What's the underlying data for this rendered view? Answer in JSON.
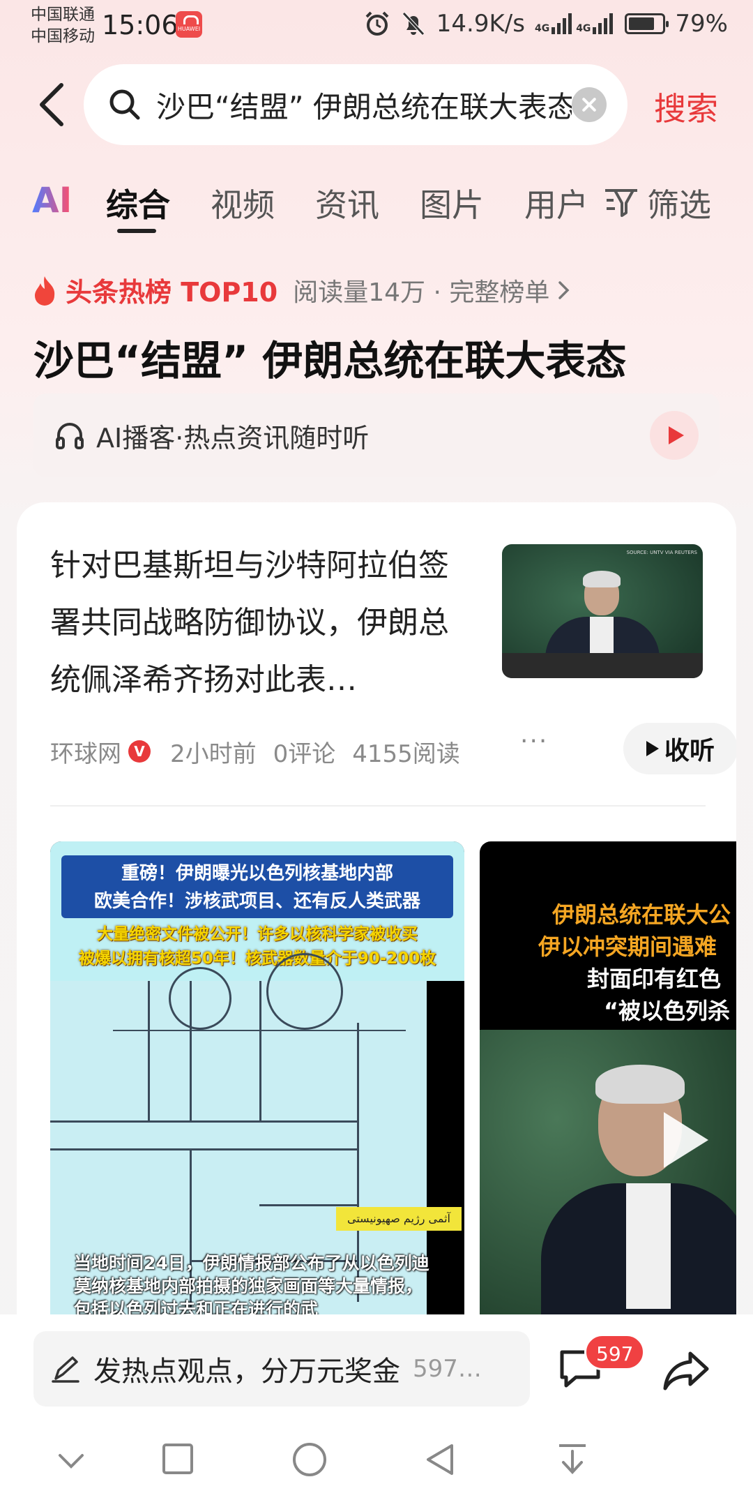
{
  "status_bar": {
    "carrier_1": "中国联通",
    "carrier_2": "中国移动",
    "time": "15:06",
    "app_badge": "HUAWEI",
    "net_speed": "14.9K/s",
    "net_tag_1": "4G",
    "net_tag_2": "4G",
    "battery_pct": "79%",
    "battery_level": 0.79,
    "icons": [
      "alarm-icon",
      "mute-icon",
      "signal-icon",
      "battery-icon"
    ]
  },
  "search": {
    "query": "沙巴“结盟” 伊朗总统在联大表态",
    "submit_label": "搜索"
  },
  "tabs": {
    "ai": "AI",
    "items": [
      "综合",
      "视频",
      "资讯",
      "图片",
      "用户"
    ],
    "active_index": 0,
    "filter_label": "筛选"
  },
  "hot": {
    "label": "头条热榜 TOP10",
    "meta": "阅读量14万 · 完整榜单",
    "title": "沙巴“结盟” 伊朗总统在联大表态",
    "podcast": "AI播客·热点资讯随时听"
  },
  "article": {
    "title": "针对巴基斯坦与沙特阿拉伯签署共同战略防御协议，伊朗总统佩泽希齐扬对此表…",
    "source": "环球网",
    "verified_mark": "V",
    "time": "2小时前",
    "comments": "0评论",
    "reads": "4155阅读",
    "more": "···",
    "listen": "收听",
    "thumb_credit": "SOURCE: UNTV VIA REUTERS"
  },
  "media_left": {
    "banner_line1": "重磅！伊朗曝光以色列核基地内部",
    "banner_line2": "欧美合作！涉核武项目、还有反人类武器",
    "yellow_line1": "大量绝密文件被公开！许多以核科学家被收买",
    "yellow_line2": "被爆以拥有核超50年！核武器数量介于90-200枚",
    "sticker": "آثمی رژیم صهیونیستی",
    "caption": "当地时间24日，伊朗情报部公布了从以色列迪莫纳核基地内部拍摄的独家画面等大量情报，包括以色列过去和正在进行的武"
  },
  "media_right": {
    "line1": "伊朗总统在联大公",
    "line2": "伊以冲突期间遇难",
    "line3": "封面印有红色",
    "line4": "“被以色列杀"
  },
  "comment_bar": {
    "prompt": "发热点观点，分万元奖金",
    "count_text": "597…",
    "badge": "597"
  },
  "colors": {
    "accent": "#e8393b",
    "text": "#222222",
    "muted": "#8a8a8a"
  }
}
